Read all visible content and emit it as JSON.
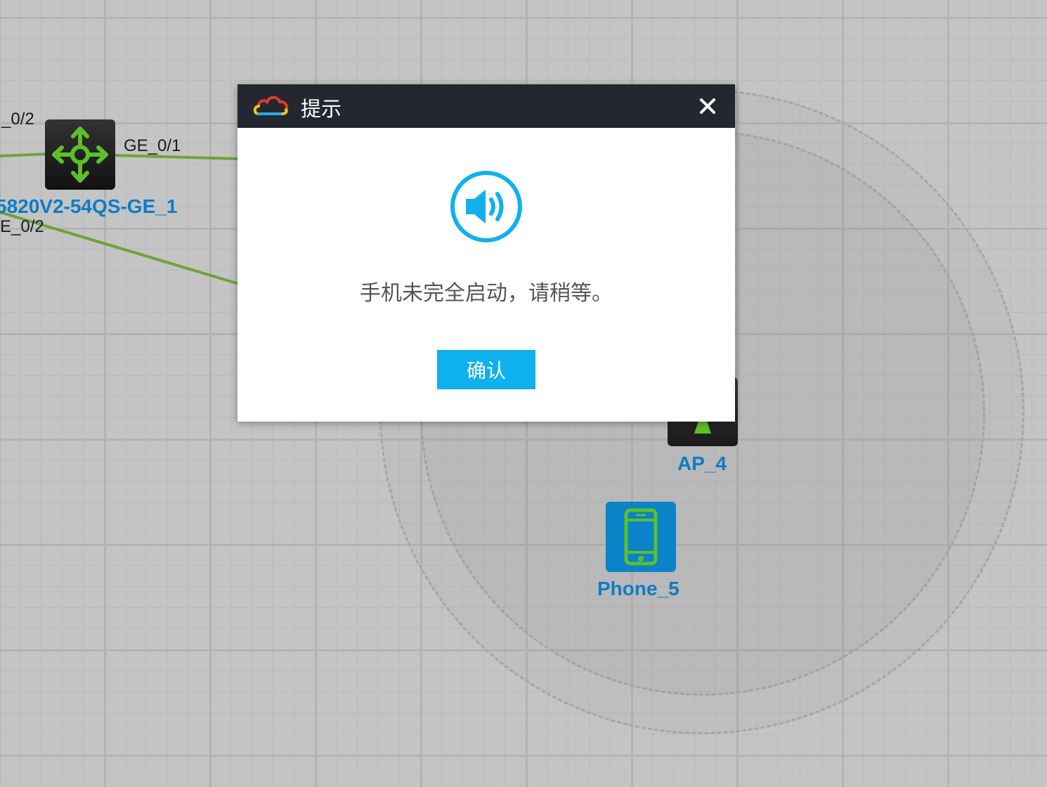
{
  "topology": {
    "switch": {
      "name": "5820V2-54QS-GE_1",
      "icon": "network-switch-icon",
      "ports": {
        "top_left": "_0/2",
        "right": "GE_0/1",
        "bottom_left": "E_0/2"
      }
    },
    "ap": {
      "name": "AP_4",
      "icon": "access-point-icon"
    },
    "phone": {
      "name": "Phone_5",
      "icon": "mobile-phone-icon"
    },
    "colors": {
      "link": "#6ea33c",
      "device_label": "#0d7cc6",
      "device_icon_green": "#5fbf2a",
      "phone_tile": "#0a83c9"
    }
  },
  "dialog": {
    "title": "提示",
    "logo_icon": "cloud-logo-icon",
    "close_icon": "close-icon",
    "status_icon": "speaker-icon",
    "message": "手机未完全启动，请稍等。",
    "confirm_label": "确认",
    "colors": {
      "header_bg": "#232830",
      "button_bg": "#0fb0ee",
      "icon": "#10b0ef"
    }
  }
}
